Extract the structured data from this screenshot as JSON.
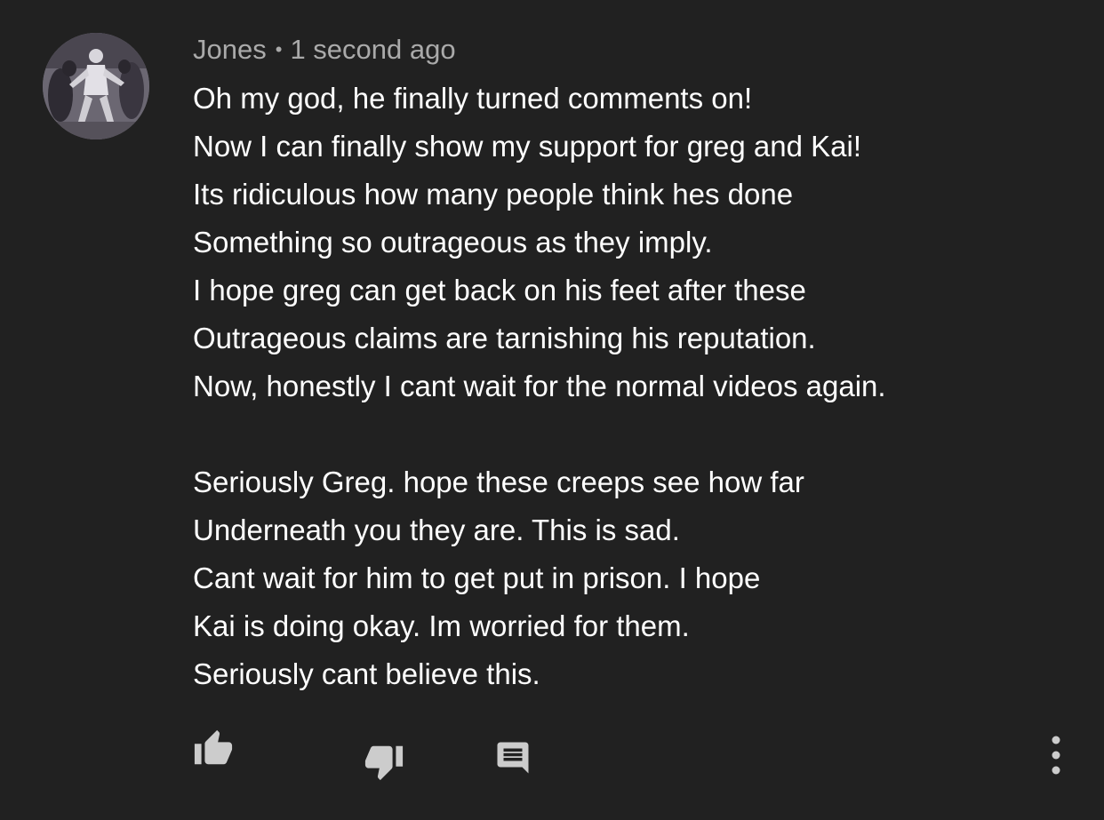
{
  "comment": {
    "author": "Jones",
    "separator": "•",
    "timestamp": "1 second ago",
    "lines": [
      "Oh my god, he finally turned comments on!",
      "Now I can finally show my support for greg and Kai!",
      "Its ridiculous how many people think hes done",
      "Something so outrageous as they imply.",
      "I hope greg can get back on his feet after these",
      "Outrageous claims are tarnishing his reputation.",
      "Now, honestly I cant wait for the normal videos again.",
      "",
      "Seriously Greg. hope these creeps see how far",
      "Underneath you they are. This is sad.",
      "Cant wait for him to get put in prison. I hope",
      "Kai is doing okay. Im worried for them.",
      "Seriously cant believe this."
    ]
  },
  "actions": {
    "like_icon": "thumbs-up-icon",
    "dislike_icon": "thumbs-down-icon",
    "reply_icon": "comment-icon",
    "more_icon": "more-vertical-icon"
  },
  "colors": {
    "background": "#212121",
    "text": "#ffffff",
    "meta": "#aaaaaa",
    "icon": "#cccccc"
  }
}
